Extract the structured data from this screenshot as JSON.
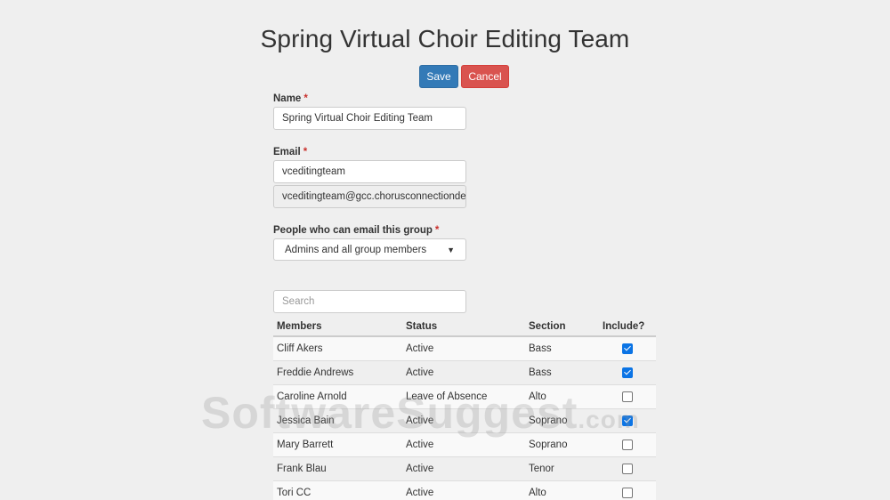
{
  "page": {
    "title": "Spring Virtual Choir Editing Team"
  },
  "actions": {
    "save_label": "Save",
    "cancel_label": "Cancel"
  },
  "form": {
    "name": {
      "label": "Name",
      "required_mark": "*",
      "value": "Spring Virtual Choir Editing Team"
    },
    "email": {
      "label": "Email",
      "required_mark": "*",
      "value": "vceditingteam",
      "full_address": "vceditingteam@gcc.chorusconnectionde"
    },
    "permission": {
      "label": "People who can email this group",
      "required_mark": "*",
      "selected": "Admins and all group members"
    },
    "search": {
      "placeholder": "Search"
    }
  },
  "table": {
    "headers": {
      "members": "Members",
      "status": "Status",
      "section": "Section",
      "include": "Include?"
    },
    "rows": [
      {
        "name": "Cliff Akers",
        "status": "Active",
        "section": "Bass",
        "include": true
      },
      {
        "name": "Freddie Andrews",
        "status": "Active",
        "section": "Bass",
        "include": true
      },
      {
        "name": "Caroline Arnold",
        "status": "Leave of Absence",
        "section": "Alto",
        "include": false
      },
      {
        "name": "Jessica Bain",
        "status": "Active",
        "section": "Soprano",
        "include": true
      },
      {
        "name": "Mary Barrett",
        "status": "Active",
        "section": "Soprano",
        "include": false
      },
      {
        "name": "Frank Blau",
        "status": "Active",
        "section": "Tenor",
        "include": false
      },
      {
        "name": "Tori CC",
        "status": "Active",
        "section": "Alto",
        "include": false
      }
    ]
  },
  "watermark": {
    "brand": "SoftwareSuggest",
    "suffix": ".com"
  },
  "colors": {
    "save": "#337ab7",
    "cancel": "#d9534f",
    "checkbox_checked": "#0b74e5",
    "required": "#c9302c"
  }
}
